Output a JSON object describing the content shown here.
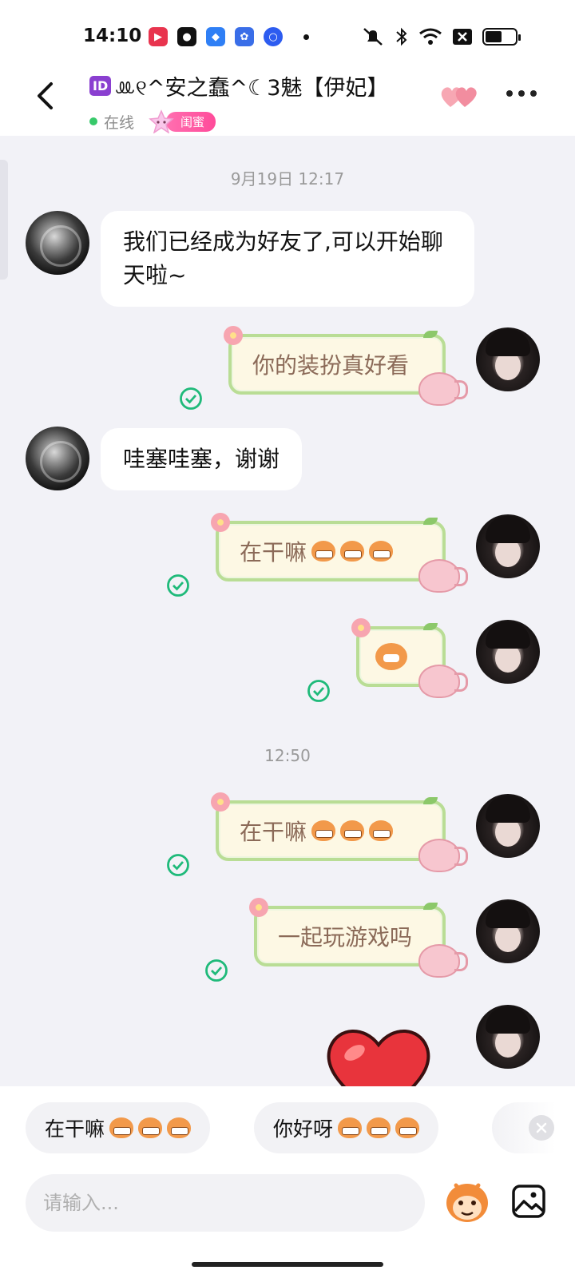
{
  "status_bar": {
    "time": "14:10",
    "battery_level": 0.55
  },
  "header": {
    "title": "ꔛ୧^安之蠢^☾3魅【伊妃】",
    "id_badge": "ID",
    "status": "在线",
    "relationship_tag": "闺蜜"
  },
  "messages": [
    {
      "type": "timestamp",
      "text": "9月19日 12:17"
    },
    {
      "type": "received",
      "text": "我们已经成为好友了,可以开始聊天啦~"
    },
    {
      "type": "sent",
      "text": "你的装扮真好看",
      "read": true
    },
    {
      "type": "received",
      "text": "哇塞哇塞，谢谢"
    },
    {
      "type": "sent",
      "text": "在干嘛",
      "emoji_count": 3,
      "read": true
    },
    {
      "type": "sent",
      "text": "",
      "sticker": "monkey-sticker",
      "read": true
    },
    {
      "type": "timestamp",
      "text": "12:50"
    },
    {
      "type": "sent",
      "text": "在干嘛",
      "emoji_count": 3,
      "read": true
    },
    {
      "type": "sent",
      "text": "一起玩游戏吗",
      "read": true
    },
    {
      "type": "sent",
      "sticker": "heart-sticker"
    }
  ],
  "quick_replies": [
    {
      "text": "在干嘛",
      "emoji_count": 3
    },
    {
      "text": "你好呀",
      "emoji_count": 3
    }
  ],
  "input": {
    "placeholder": "请输入..."
  },
  "colors": {
    "online": "#37c96a",
    "read_check": "#1fba7a",
    "bubble_sent_bg": "#fdf8e4",
    "bubble_sent_border": "#b9dd95",
    "bubble_sent_text": "#8b6a58",
    "tag_pink": "#ff4b9a"
  }
}
